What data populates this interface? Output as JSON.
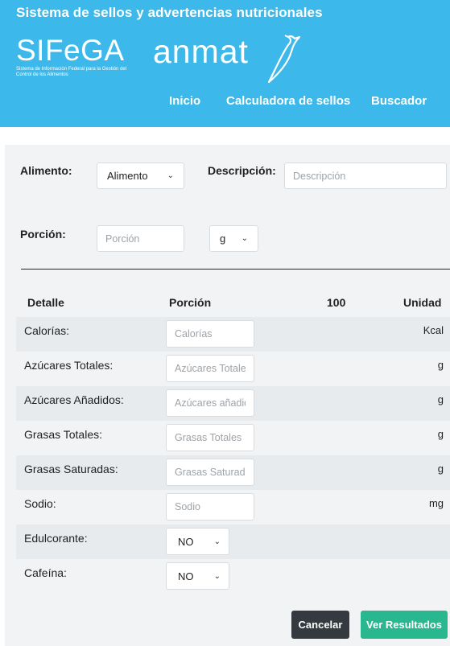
{
  "header": {
    "title": "Sistema de sellos y advertencias nutricionales",
    "sifega_logo": "SIFeGA",
    "sifega_subtitle": "Sistema de Información Federal para la Gestión del Control de los Alimentos",
    "anmat_logo": "anmat",
    "nav": [
      {
        "label": "Inicio"
      },
      {
        "label": "Calculadora de sellos"
      },
      {
        "label": "Buscador"
      }
    ]
  },
  "form": {
    "alimento_label": "Alimento:",
    "alimento_value": "Alimento",
    "descripcion_label": "Descripción:",
    "descripcion_placeholder": "Descripción",
    "porcion_label": "Porción:",
    "porcion_placeholder": "Porción",
    "unit_value": "g"
  },
  "table": {
    "headers": {
      "detalle": "Detalle",
      "porcion": "Porción",
      "cien": "100",
      "unidad": "Unidad"
    },
    "rows": [
      {
        "label": "Calorías:",
        "placeholder": "Calorías",
        "unit": "Kcal"
      },
      {
        "label": "Azúcares Totales:",
        "placeholder": "Azúcares Totales",
        "unit": "g"
      },
      {
        "label": "Azúcares Añadidos:",
        "placeholder": "Azúcares añadidos",
        "unit": "g"
      },
      {
        "label": "Grasas Totales:",
        "placeholder": "Grasas Totales",
        "unit": "g"
      },
      {
        "label": "Grasas Saturadas:",
        "placeholder": "Grasas Saturadas",
        "unit": "g"
      },
      {
        "label": "Sodio:",
        "placeholder": "Sodio",
        "unit": "mg"
      }
    ],
    "selects": [
      {
        "label": "Edulcorante:",
        "value": "NO"
      },
      {
        "label": "Cafeína:",
        "value": "NO"
      }
    ]
  },
  "actions": {
    "cancel_label": "Cancelar",
    "results_label": "Ver Resultados"
  },
  "colors": {
    "header_bg": "#3db8ea",
    "panel_bg": "#f2f3f4",
    "cancel_bg": "#343a40",
    "results_bg": "#28b78f"
  }
}
